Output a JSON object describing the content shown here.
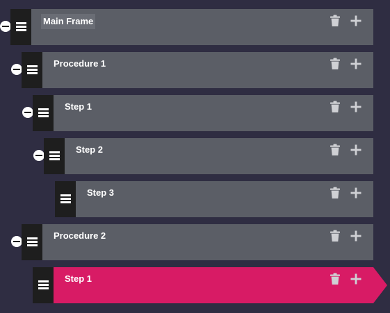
{
  "colors": {
    "background": "#2f2d42",
    "panel": "#5b5e66",
    "selected_panel": "#d81b65",
    "handle": "#1e1e1e",
    "icon": "#ffffff"
  },
  "icons": {
    "collapse": "minus-circle-icon",
    "drag_handle": "hamburger-icon",
    "delete": "trash-icon",
    "add": "plus-icon"
  },
  "tree": {
    "items": [
      {
        "label": "Main Frame",
        "level": 0,
        "collapsible": true,
        "selected": false,
        "label_box": true
      },
      {
        "label": "Procedure 1",
        "level": 1,
        "collapsible": true,
        "selected": false,
        "label_box": false
      },
      {
        "label": "Step 1",
        "level": 2,
        "collapsible": true,
        "selected": false,
        "label_box": false
      },
      {
        "label": "Step 2",
        "level": 3,
        "collapsible": true,
        "selected": false,
        "label_box": false
      },
      {
        "label": "Step 3",
        "level": 4,
        "collapsible": false,
        "selected": false,
        "label_box": false
      },
      {
        "label": "Procedure 2",
        "level": 1,
        "collapsible": true,
        "selected": false,
        "label_box": false
      },
      {
        "label": "Step 1",
        "level": 2,
        "collapsible": false,
        "selected": true,
        "label_box": false
      }
    ]
  }
}
